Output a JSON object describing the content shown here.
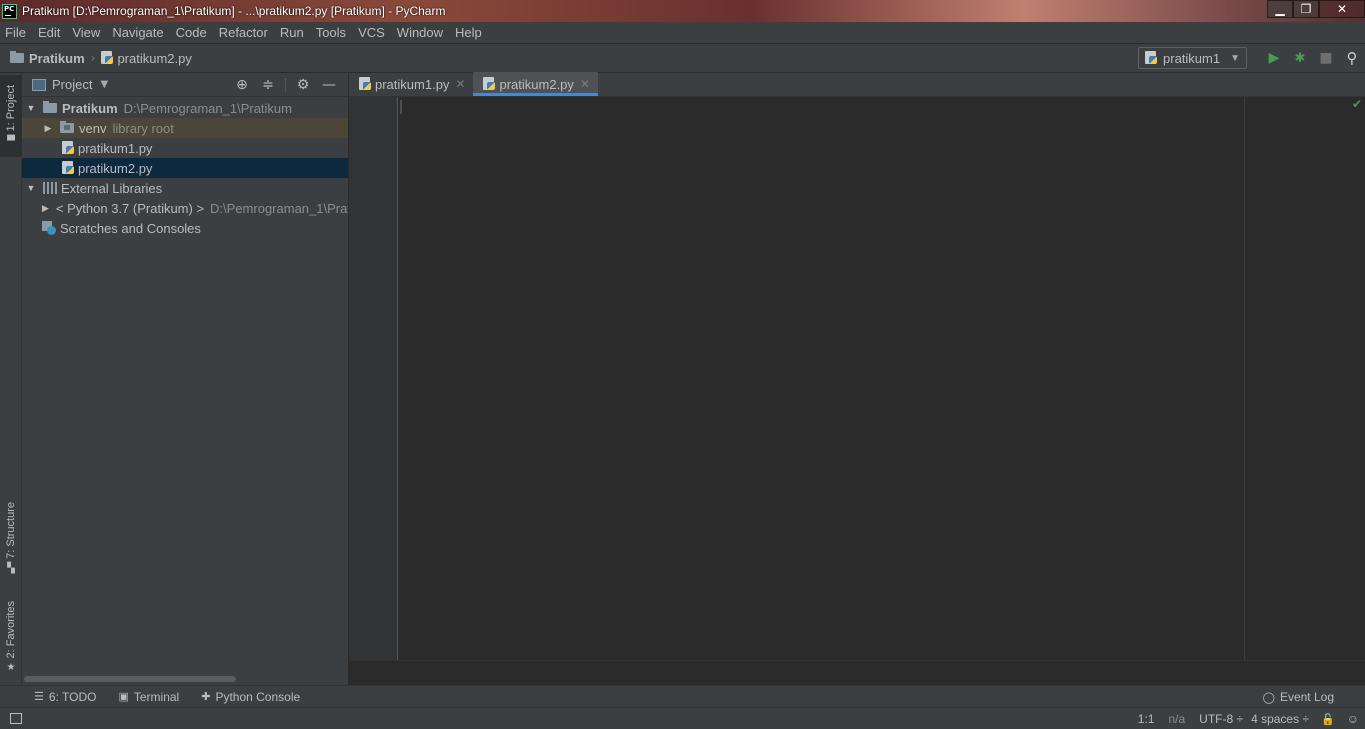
{
  "window": {
    "title": "Pratikum [D:\\Pemrograman_1\\Pratikum] - ...\\pratikum2.py [Pratikum] - PyCharm",
    "logo": "PC",
    "min_label": "▁",
    "max_label": "❐",
    "close_label": "✕"
  },
  "menu": [
    "File",
    "Edit",
    "View",
    "Navigate",
    "Code",
    "Refactor",
    "Run",
    "Tools",
    "VCS",
    "Window",
    "Help"
  ],
  "navbar": {
    "project": "Pratikum",
    "file": "pratikum2.py",
    "run_config": "pratikum1"
  },
  "left_strip": {
    "project_tab": "1: Project",
    "structure_tab": "7: Structure",
    "favorites_tab": "2: Favorites"
  },
  "project_panel": {
    "title": "Project",
    "tree": {
      "root_name": "Pratikum",
      "root_path": "D:\\Pemrograman_1\\Pratikum",
      "venv_name": "venv",
      "venv_note": "library root",
      "file1": "pratikum1.py",
      "file2": "pratikum2.py",
      "ext_libs": "External Libraries",
      "python_sdk": "< Python 3.7 (Pratikum) >",
      "python_sdk_path": "D:\\Pemrograman_1\\Prat",
      "scratches": "Scratches and Consoles"
    }
  },
  "editor": {
    "tabs": [
      {
        "label": "pratikum1.py",
        "active": false
      },
      {
        "label": "pratikum2.py",
        "active": true
      }
    ]
  },
  "bottom_tools": {
    "todo": "6: TODO",
    "terminal": "Terminal",
    "python_console": "Python Console",
    "event_log": "Event Log"
  },
  "status": {
    "position": "1:1",
    "na": "n/a",
    "encoding": "UTF-8 ÷",
    "indent": "4 spaces ÷"
  },
  "colors": {
    "accent": "#4a88c7",
    "run_green": "#499c54",
    "selection": "#0d293e",
    "editor_bg": "#2b2b2b",
    "panel_bg": "#3c3f41"
  }
}
